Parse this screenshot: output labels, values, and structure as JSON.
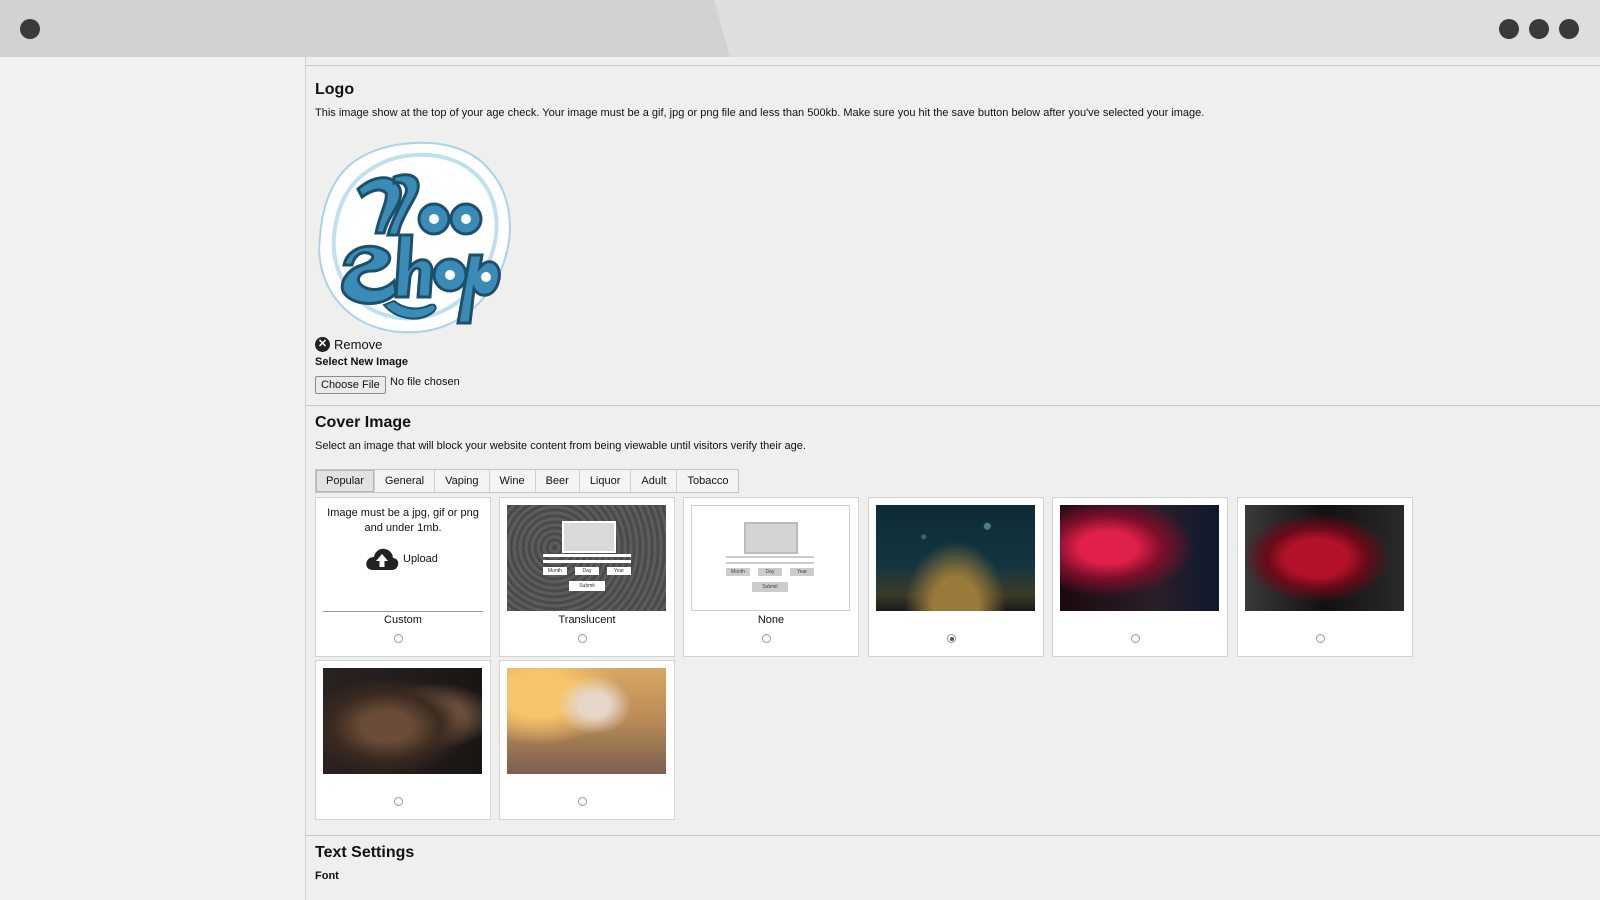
{
  "logo_section": {
    "title": "Logo",
    "description": "This image show at the top of your age check. Your image must be a gif, jpg or png file and less than 500kb. Make sure you hit the save button below after you've selected your image.",
    "remove_label": "Remove",
    "select_label": "Select New Image",
    "choose_file_label": "Choose File",
    "no_file_text": "No file chosen"
  },
  "cover_section": {
    "title": "Cover Image",
    "description": "Select an image that will block your website content from being viewable until visitors verify their age.",
    "tabs": [
      {
        "label": "Popular",
        "active": true
      },
      {
        "label": "General"
      },
      {
        "label": "Vaping"
      },
      {
        "label": "Wine"
      },
      {
        "label": "Beer"
      },
      {
        "label": "Liquor"
      },
      {
        "label": "Adult"
      },
      {
        "label": "Tobacco"
      }
    ],
    "custom_card": {
      "hint": "Image must be a jpg, gif or png and under 1mb.",
      "upload_label": "Upload",
      "name": "Custom"
    },
    "translucent_name": "Translucent",
    "none_name": "None",
    "mock_form": {
      "month": "Month",
      "day": "Day",
      "year": "Year",
      "submit": "Submit"
    },
    "selected_option_index": 3
  },
  "text_section": {
    "title": "Text Settings",
    "font_label": "Font"
  },
  "colors": {
    "accent_blue": "#3a8bb5",
    "dark_blue": "#1d4f6b"
  }
}
